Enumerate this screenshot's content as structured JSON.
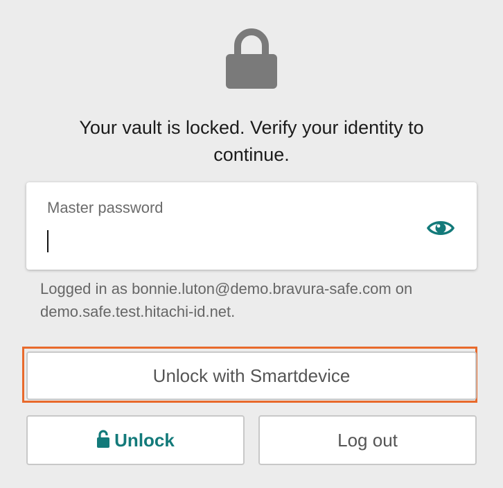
{
  "lock_screen": {
    "message": "Your vault is locked. Verify your identity to continue.",
    "password_label": "Master password",
    "password_value": "",
    "login_info": "Logged in as bonnie.luton@demo.bravura-safe.com on demo.safe.test.hitachi-id.net.",
    "smartdevice_button": "Unlock with Smartdevice",
    "unlock_button": "Unlock",
    "logout_button": "Log out"
  },
  "icons": {
    "hero": "lock-icon",
    "toggle_visibility": "eye-icon",
    "unlock_button": "unlocked-padlock-icon"
  },
  "colors": {
    "background": "#ececec",
    "accent_teal": "#137a7a",
    "lock_gray": "#7a7a7a",
    "highlight_orange": "#e86a2c"
  }
}
